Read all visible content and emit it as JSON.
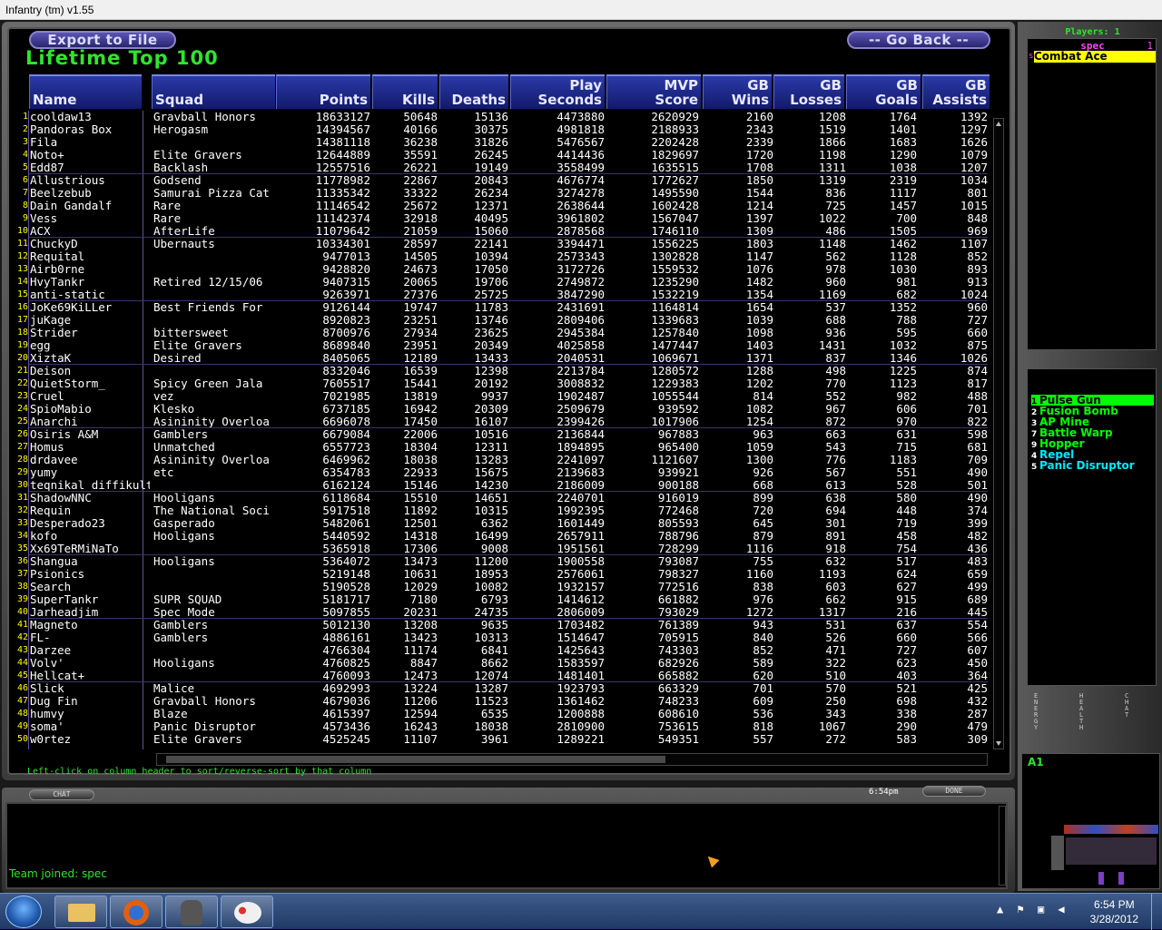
{
  "window": {
    "title": "Infantry (tm) v1.55"
  },
  "toolbar": {
    "export_label": "Export to File",
    "back_label": "-- Go Back --"
  },
  "page": {
    "title": "Lifetime Top 100"
  },
  "columns": [
    {
      "key": "name",
      "line1": "",
      "line2": "Name",
      "align": "left"
    },
    {
      "key": "squad",
      "line1": "",
      "line2": "Squad",
      "align": "left"
    },
    {
      "key": "points",
      "line1": "",
      "line2": "Points",
      "align": "right"
    },
    {
      "key": "kills",
      "line1": "",
      "line2": "Kills",
      "align": "right"
    },
    {
      "key": "deaths",
      "line1": "",
      "line2": "Deaths",
      "align": "right"
    },
    {
      "key": "play",
      "line1": "Play",
      "line2": "Seconds",
      "align": "right"
    },
    {
      "key": "mvp",
      "line1": "MVP",
      "line2": "Score",
      "align": "right"
    },
    {
      "key": "gbw",
      "line1": "GB",
      "line2": "Wins",
      "align": "right"
    },
    {
      "key": "gbl",
      "line1": "GB",
      "line2": "Losses",
      "align": "right"
    },
    {
      "key": "gbg",
      "line1": "GB",
      "line2": "Goals",
      "align": "right"
    },
    {
      "key": "gba",
      "line1": "GB",
      "line2": "Assists",
      "align": "right"
    }
  ],
  "rows": [
    [
      "1",
      "cooldaw13",
      "Gravball Honors",
      "18633127",
      "50648",
      "15136",
      "4473880",
      "2620929",
      "2160",
      "1208",
      "1764",
      "1392"
    ],
    [
      "2",
      "Pandoras Box",
      "Herogasm",
      "14394567",
      "40166",
      "30375",
      "4981818",
      "2188933",
      "2343",
      "1519",
      "1401",
      "1297"
    ],
    [
      "3",
      "Fila",
      "",
      "14381118",
      "36238",
      "31826",
      "5476567",
      "2202428",
      "2339",
      "1866",
      "1683",
      "1626"
    ],
    [
      "4",
      "Noto+",
      "Elite Gravers",
      "12644889",
      "35591",
      "26245",
      "4414436",
      "1829697",
      "1720",
      "1198",
      "1290",
      "1079"
    ],
    [
      "5",
      "Edd87",
      "Backlash",
      "12557516",
      "26221",
      "19149",
      "3558499",
      "1635515",
      "1708",
      "1311",
      "1038",
      "1207"
    ],
    [
      "6",
      "Allustrious",
      "Godsend",
      "11778982",
      "22867",
      "20843",
      "4676774",
      "1772627",
      "1850",
      "1319",
      "2319",
      "1034"
    ],
    [
      "7",
      "Beelzebub",
      "Samurai Pizza Cat",
      "11335342",
      "33322",
      "26234",
      "3274278",
      "1495590",
      "1544",
      "836",
      "1117",
      "801"
    ],
    [
      "8",
      "Dain Gandalf",
      "Rare",
      "11146542",
      "25672",
      "12371",
      "2638644",
      "1602428",
      "1214",
      "725",
      "1457",
      "1015"
    ],
    [
      "9",
      "Vess",
      "Rare",
      "11142374",
      "32918",
      "40495",
      "3961802",
      "1567047",
      "1397",
      "1022",
      "700",
      "848"
    ],
    [
      "10",
      "ACX",
      "AfterLife",
      "11079642",
      "21059",
      "15060",
      "2878568",
      "1746110",
      "1309",
      "486",
      "1505",
      "969"
    ],
    [
      "11",
      "ChuckyD",
      "Ubernauts",
      "10334301",
      "28597",
      "22141",
      "3394471",
      "1556225",
      "1803",
      "1148",
      "1462",
      "1107"
    ],
    [
      "12",
      "Requital",
      "",
      "9477013",
      "14505",
      "10394",
      "2573343",
      "1302828",
      "1147",
      "562",
      "1128",
      "852"
    ],
    [
      "13",
      "Airb0rne",
      "",
      "9428820",
      "24673",
      "17050",
      "3172726",
      "1559532",
      "1076",
      "978",
      "1030",
      "893"
    ],
    [
      "14",
      "HvyTankr",
      "Retired 12/15/06",
      "9407315",
      "20065",
      "19706",
      "2749872",
      "1235290",
      "1482",
      "960",
      "981",
      "913"
    ],
    [
      "15",
      "anti-static",
      "",
      "9263971",
      "27376",
      "25725",
      "3847290",
      "1532219",
      "1354",
      "1169",
      "682",
      "1024"
    ],
    [
      "16",
      "JoKe69KiLLer",
      "Best Friends For",
      "9126144",
      "19747",
      "11783",
      "2431691",
      "1164814",
      "1654",
      "537",
      "1352",
      "960"
    ],
    [
      "17",
      "juKage",
      "",
      "8920823",
      "23251",
      "13746",
      "2809406",
      "1339683",
      "1039",
      "688",
      "788",
      "727"
    ],
    [
      "18",
      "Strider",
      "bittersweet",
      "8700976",
      "27934",
      "23625",
      "2945384",
      "1257840",
      "1098",
      "936",
      "595",
      "660"
    ],
    [
      "19",
      "egg",
      "Elite Gravers",
      "8689840",
      "23951",
      "20349",
      "4025858",
      "1477447",
      "1403",
      "1431",
      "1032",
      "875"
    ],
    [
      "20",
      "XiztaK",
      "Desired",
      "8405065",
      "12189",
      "13433",
      "2040531",
      "1069671",
      "1371",
      "837",
      "1346",
      "1026"
    ],
    [
      "21",
      "Deison",
      "",
      "8332046",
      "16539",
      "12398",
      "2213784",
      "1280572",
      "1288",
      "498",
      "1225",
      "874"
    ],
    [
      "22",
      "QuietStorm_",
      "Spicy Green Jala",
      "7605517",
      "15441",
      "20192",
      "3008832",
      "1229383",
      "1202",
      "770",
      "1123",
      "817"
    ],
    [
      "23",
      "Cruel",
      "vez",
      "7021985",
      "13819",
      "9937",
      "1902487",
      "1055544",
      "814",
      "552",
      "982",
      "488"
    ],
    [
      "24",
      "SpioMabio",
      "Klesko",
      "6737185",
      "16942",
      "20309",
      "2509679",
      "939592",
      "1082",
      "967",
      "606",
      "701"
    ],
    [
      "25",
      "Anarchi",
      "Asininity Overloa",
      "6696078",
      "17450",
      "16107",
      "2399426",
      "1017906",
      "1254",
      "872",
      "970",
      "822"
    ],
    [
      "26",
      "Osiris A&M",
      "Gamblers",
      "6679084",
      "22006",
      "10516",
      "2136844",
      "967883",
      "963",
      "663",
      "631",
      "598"
    ],
    [
      "27",
      "Homus",
      "Unmatched",
      "6557723",
      "18304",
      "12311",
      "1894895",
      "965400",
      "1059",
      "543",
      "715",
      "681"
    ],
    [
      "28",
      "drdavee",
      "Asininity Overloa",
      "6469962",
      "18038",
      "13283",
      "2241097",
      "1121607",
      "1300",
      "776",
      "1183",
      "709"
    ],
    [
      "29",
      "yumy",
      "etc",
      "6354783",
      "22933",
      "15675",
      "2139683",
      "939921",
      "926",
      "567",
      "551",
      "490"
    ],
    [
      "30",
      "teqnikal diffikulti",
      "",
      "6162124",
      "15146",
      "14230",
      "2186009",
      "900188",
      "668",
      "613",
      "528",
      "501"
    ],
    [
      "31",
      "ShadowNNC",
      "Hooligans",
      "6118684",
      "15510",
      "14651",
      "2240701",
      "916019",
      "899",
      "638",
      "580",
      "490"
    ],
    [
      "32",
      "Requin",
      "The National Soci",
      "5917518",
      "11892",
      "10315",
      "1992395",
      "772468",
      "720",
      "694",
      "448",
      "374"
    ],
    [
      "33",
      "Desperado23",
      "Gasperado",
      "5482061",
      "12501",
      "6362",
      "1601449",
      "805593",
      "645",
      "301",
      "719",
      "399"
    ],
    [
      "34",
      "kofo",
      "Hooligans",
      "5440592",
      "14318",
      "16499",
      "2657911",
      "788796",
      "879",
      "891",
      "458",
      "482"
    ],
    [
      "35",
      "Xx69TeRMiNaTo",
      "",
      "5365918",
      "17306",
      "9008",
      "1951561",
      "728299",
      "1116",
      "918",
      "754",
      "436"
    ],
    [
      "36",
      "Shangua",
      "Hooligans",
      "5364072",
      "13473",
      "11200",
      "1900558",
      "793087",
      "755",
      "632",
      "517",
      "483"
    ],
    [
      "37",
      "Psionics",
      "",
      "5219148",
      "10631",
      "18953",
      "2576061",
      "798327",
      "1160",
      "1193",
      "624",
      "659"
    ],
    [
      "38",
      "Search",
      "",
      "5190528",
      "12029",
      "10082",
      "1932157",
      "772516",
      "838",
      "603",
      "627",
      "499"
    ],
    [
      "39",
      "SuperTankr",
      "SUPR SQUAD",
      "5181717",
      "7180",
      "6793",
      "1414612",
      "661882",
      "976",
      "662",
      "915",
      "689"
    ],
    [
      "40",
      "Jarheadjim",
      "Spec Mode",
      "5097855",
      "20231",
      "24735",
      "2806009",
      "793029",
      "1272",
      "1317",
      "216",
      "445"
    ],
    [
      "41",
      "Magneto",
      "Gamblers",
      "5012130",
      "13208",
      "9635",
      "1703482",
      "761389",
      "943",
      "531",
      "637",
      "554"
    ],
    [
      "42",
      "FL-",
      "Gamblers",
      "4886161",
      "13423",
      "10313",
      "1514647",
      "705915",
      "840",
      "526",
      "660",
      "566"
    ],
    [
      "43",
      "Darzee",
      "",
      "4766304",
      "11174",
      "6841",
      "1425643",
      "743303",
      "852",
      "471",
      "727",
      "607"
    ],
    [
      "44",
      "Volv'",
      "Hooligans",
      "4760825",
      "8847",
      "8662",
      "1583597",
      "682926",
      "589",
      "322",
      "623",
      "450"
    ],
    [
      "45",
      "Hellcat+",
      "",
      "4760093",
      "12473",
      "12074",
      "1481401",
      "665882",
      "620",
      "510",
      "403",
      "364"
    ],
    [
      "46",
      "Slick",
      "Malice",
      "4692993",
      "13224",
      "13287",
      "1923793",
      "663329",
      "701",
      "570",
      "521",
      "425"
    ],
    [
      "47",
      "Dug Fin",
      "Gravball Honors",
      "4679036",
      "11206",
      "11523",
      "1361462",
      "748233",
      "609",
      "250",
      "698",
      "432"
    ],
    [
      "48",
      "humvy",
      "Blaze",
      "4615397",
      "12594",
      "6535",
      "1200888",
      "608610",
      "536",
      "343",
      "338",
      "287"
    ],
    [
      "49",
      "soma'",
      "Panic Disruptor",
      "4573436",
      "16243",
      "18038",
      "2810900",
      "753615",
      "818",
      "1067",
      "290",
      "479"
    ],
    [
      "50",
      "w0rtez",
      "Elite Gravers",
      "4525245",
      "11107",
      "3961",
      "1289221",
      "549351",
      "557",
      "272",
      "583",
      "309"
    ]
  ],
  "hint": "Left-click on column header to sort/reverse-sort by that column",
  "chat": {
    "tab_label": "CHAT",
    "time": "6:54pm",
    "done_label": "DONE",
    "message": "Team joined: spec"
  },
  "players": {
    "header": "Players: 1",
    "group": "spec",
    "count": "1",
    "marker": "s",
    "name": "Combat Ace"
  },
  "items": [
    {
      "num": "1",
      "label": "Pulse Gun",
      "color": "#00ff00",
      "highlight": true
    },
    {
      "num": "2",
      "label": "Fusion Bomb",
      "color": "#00ff00",
      "highlight": false
    },
    {
      "num": "3",
      "label": "AP Mine",
      "color": "#00ff00",
      "highlight": false
    },
    {
      "num": "7",
      "label": "Battle Warp",
      "color": "#00ff00",
      "highlight": false
    },
    {
      "num": "9",
      "label": "Hopper",
      "color": "#00ff00",
      "highlight": false
    },
    {
      "num": "4",
      "label": "Repel",
      "color": "#00e8ff",
      "highlight": false
    },
    {
      "num": "5",
      "label": "Panic Disruptor",
      "color": "#00e8ff",
      "highlight": false
    }
  ],
  "gauges": [
    "ENERGY",
    "HEALTH",
    "CHAT"
  ],
  "minimap": {
    "label": "A1"
  },
  "taskbar": {
    "time": "6:54 PM",
    "date": "3/28/2012"
  },
  "colors": {
    "accent_green": "#2ee52e",
    "header_blue": "#1a2a9a",
    "rank_yellow": "#ffff00",
    "highlight_yellow": "#ffff00"
  }
}
